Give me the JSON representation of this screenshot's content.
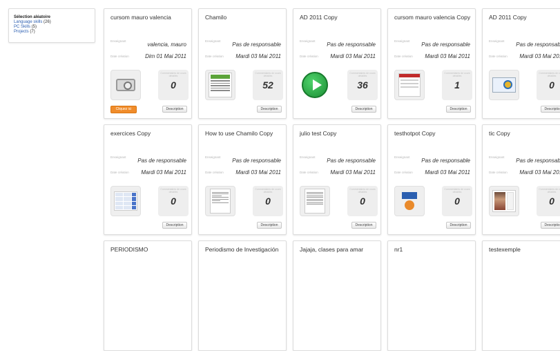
{
  "sidebar": {
    "title": "Sélection aléatoire",
    "items": [
      {
        "label": "Language skills",
        "count": "(26)"
      },
      {
        "label": "PC Skills",
        "count": "(5)"
      },
      {
        "label": "Projects",
        "count": "(7)"
      }
    ]
  },
  "labels": {
    "teacher": "Enseignant",
    "date": "Date création",
    "counter": "Commentaires de cours détaillés",
    "description": "Description",
    "open": "Cliquez ici"
  },
  "cards": [
    {
      "title": "cursom mauro valencia",
      "teacher": "valencia, mauro",
      "date": "Dim 01 Mai 2011",
      "count": "0",
      "thumb": "camera-icon"
    },
    {
      "title": "Chamilo",
      "teacher": "Pas de responsable",
      "date": "Mardi 03 Mai 2011",
      "count": "52",
      "thumb": "chamilo-doc-icon"
    },
    {
      "title": "AD 2011 Copy",
      "teacher": "Pas de responsable",
      "date": "Mardi 03 Mai 2011",
      "count": "36",
      "thumb": "play-icon"
    },
    {
      "title": "cursom mauro valencia Copy",
      "teacher": "Pas de responsable",
      "date": "Mardi 03 Mai 2011",
      "count": "1",
      "thumb": "hotpot-doc-icon"
    },
    {
      "title": "AD 2011 Copy",
      "teacher": "Pas de responsable",
      "date": "Mardi 03 Mai 2011",
      "count": "0",
      "thumb": "certificate-icon"
    },
    {
      "title": "exercices Copy",
      "teacher": "Pas de responsable",
      "date": "Mardi 03 Mai 2011",
      "count": "0",
      "thumb": "table-doc-icon"
    },
    {
      "title": "How to use Chamilo Copy",
      "teacher": "Pas de responsable",
      "date": "Mardi 03 Mai 2011",
      "count": "0",
      "thumb": "guide-doc-icon"
    },
    {
      "title": "julio test Copy",
      "teacher": "Pas de responsable",
      "date": "Mardi 03 Mai 2011",
      "count": "0",
      "thumb": "text-doc-icon"
    },
    {
      "title": "testhotpot Copy",
      "teacher": "Pas de responsable",
      "date": "Mardi 03 Mai 2011",
      "count": "0",
      "thumb": "hotpot-icon"
    },
    {
      "title": "tic Copy",
      "teacher": "Pas de responsable",
      "date": "Mardi 03 Mai 2011",
      "count": "0",
      "thumb": "photo-id-icon"
    },
    {
      "title": "PERIODISMO"
    },
    {
      "title": "Periodismo de Investigación"
    },
    {
      "title": "Jajaja, clases para amar"
    },
    {
      "title": "nr1"
    },
    {
      "title": "testexemple"
    }
  ]
}
